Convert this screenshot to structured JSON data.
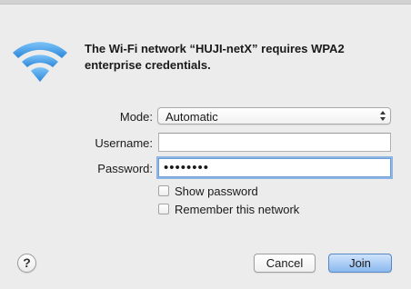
{
  "dialog": {
    "message": "The Wi-Fi network “HUJI-netX” requires WPA2 enterprise credentials."
  },
  "icons": {
    "wifi": "wifi-icon",
    "help": "question-mark-icon",
    "select_arrows": "up-down-arrows-icon"
  },
  "form": {
    "mode_label": "Mode:",
    "mode_value": "Automatic",
    "username_label": "Username:",
    "username_value": "",
    "password_label": "Password:",
    "password_value": "••••••••"
  },
  "options": {
    "show_password": {
      "label": "Show password",
      "checked": false
    },
    "remember_network": {
      "label": "Remember this network",
      "checked": false
    }
  },
  "buttons": {
    "help_label": "?",
    "cancel_label": "Cancel",
    "join_label": "Join"
  },
  "colors": {
    "wifi_blue": "#3f9ae6",
    "focus_ring": "#8cb4e4",
    "default_button": "#8ab8ef"
  }
}
